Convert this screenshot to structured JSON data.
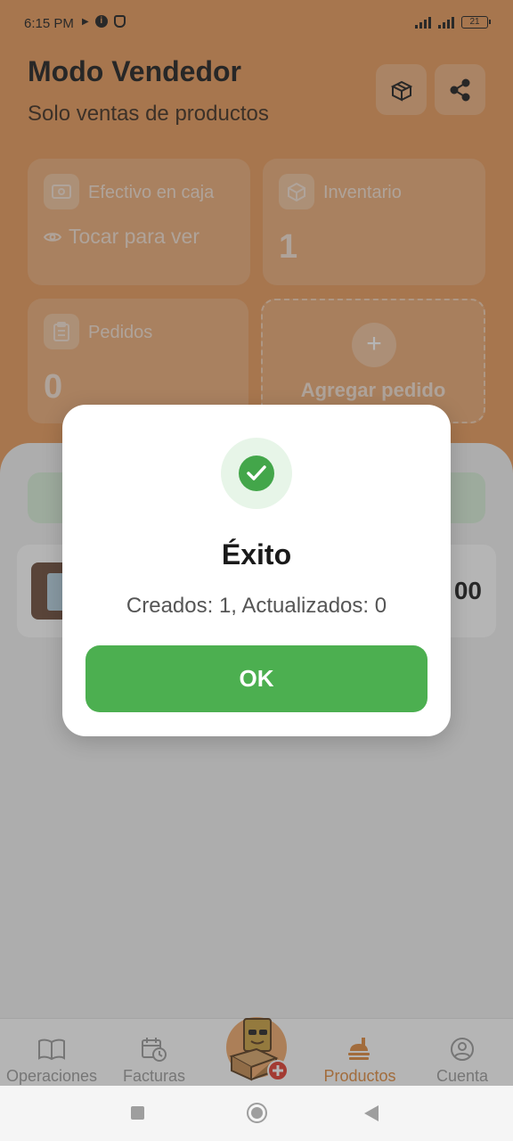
{
  "status_bar": {
    "time": "6:15 PM",
    "battery": "21"
  },
  "header": {
    "title": "Modo Vendedor",
    "subtitle": "Solo ventas de productos",
    "buttons": [
      {
        "icon": "box-icon"
      },
      {
        "icon": "share-icon"
      }
    ]
  },
  "cards": {
    "cash": {
      "label": "Efectivo en caja",
      "tap_text": "Tocar para ver",
      "icon": "cash-icon"
    },
    "inventory": {
      "label": "Inventario",
      "value": "1",
      "icon": "cube-icon"
    },
    "orders": {
      "label": "Pedidos",
      "value": "0",
      "icon": "clipboard-icon"
    },
    "add_order": {
      "label": "Agregar pedido",
      "icon": "plus-icon"
    }
  },
  "product": {
    "price_partial": "00"
  },
  "bottom_nav": {
    "items": [
      {
        "label": "Operaciones",
        "icon": "book-icon",
        "active": false
      },
      {
        "label": "Facturas",
        "icon": "calendar-clock-icon",
        "active": false
      },
      {
        "label": "Productos",
        "icon": "food-tray-icon",
        "active": true
      },
      {
        "label": "Cuenta",
        "icon": "user-icon",
        "active": false
      }
    ]
  },
  "dialog": {
    "title": "Éxito",
    "message": "Creados: 1, Actualizados: 0",
    "ok_label": "OK"
  },
  "colors": {
    "header": "#e89a5a",
    "accent_green": "#4caf50",
    "active_nav": "#e08a3c"
  }
}
